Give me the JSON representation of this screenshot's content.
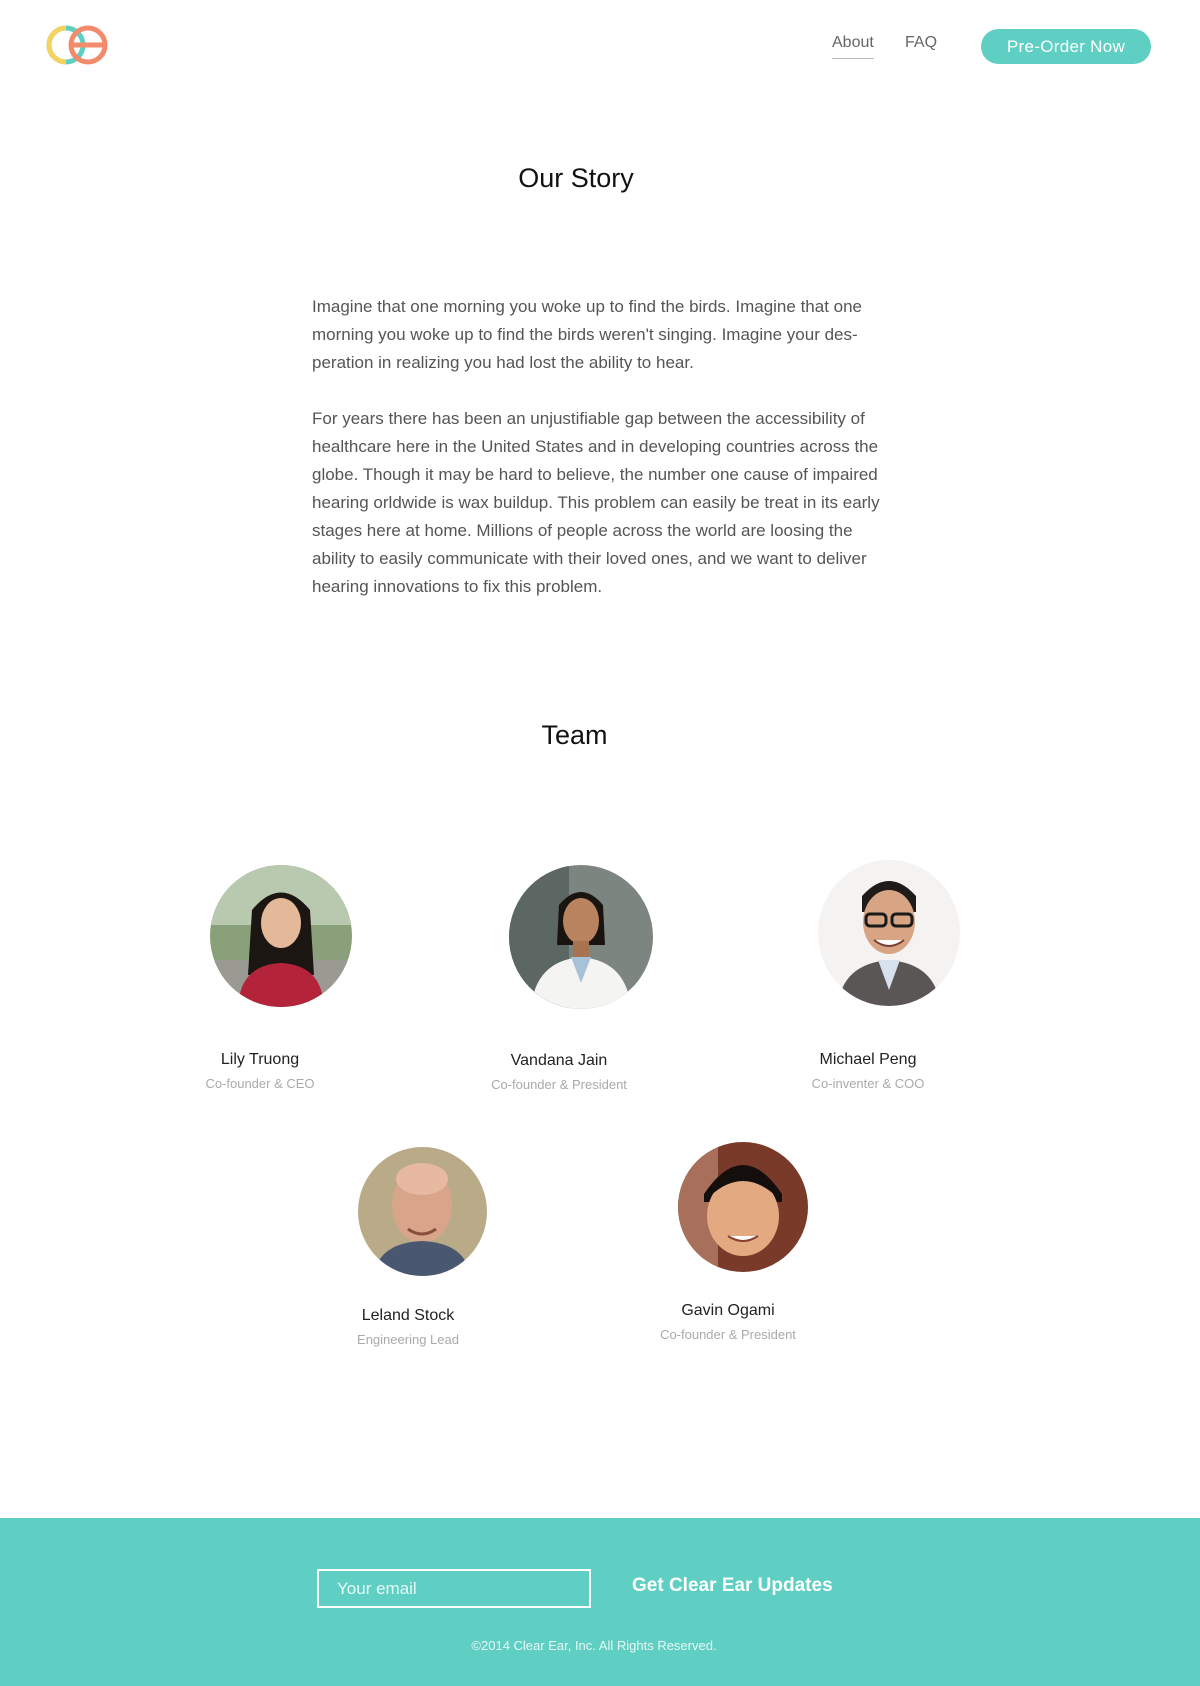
{
  "header": {
    "nav": {
      "about": "About",
      "faq": "FAQ"
    },
    "preorder_label": "Pre-Order Now"
  },
  "story": {
    "title": "Our Story",
    "paragraph_1": "Imagine that one morning you woke up to find the birds. Imagine that one morning you woke up to find the birds weren't singing. Imagine your des-peration in realizing you had lost the ability to hear.",
    "paragraph_2": "For years there has been an unjustifiable gap between the accessibility of healthcare here in the United States and in developing countries across the globe. Though it may be hard to believe, the number one cause of impaired hearing orldwide is wax buildup. This problem can easily be treat in its early stages here at home. Millions of people across the world are loosing the ability to easily communicate with their loved ones, and we want to deliver hearing innovations to fix this problem."
  },
  "team": {
    "title": "Team",
    "members": [
      {
        "name": "Lily Truong",
        "role": "Co-founder & CEO"
      },
      {
        "name": "Vandana Jain",
        "role": "Co-founder & President"
      },
      {
        "name": "Michael Peng",
        "role": "Co-inventer & COO"
      },
      {
        "name": "Leland Stock",
        "role": "Engineering Lead"
      },
      {
        "name": "Gavin Ogami",
        "role": "Co-founder & President"
      }
    ]
  },
  "footer": {
    "email_placeholder": "Your email",
    "updates_label": "Get Clear Ear Updates",
    "copyright": "©2014 Clear Ear, Inc. All Rights Reserved."
  },
  "colors": {
    "accent": "#5fcfc3",
    "logo_yellow": "#f4d35e",
    "logo_coral": "#f28b6b",
    "logo_teal": "#5fcfc3"
  }
}
